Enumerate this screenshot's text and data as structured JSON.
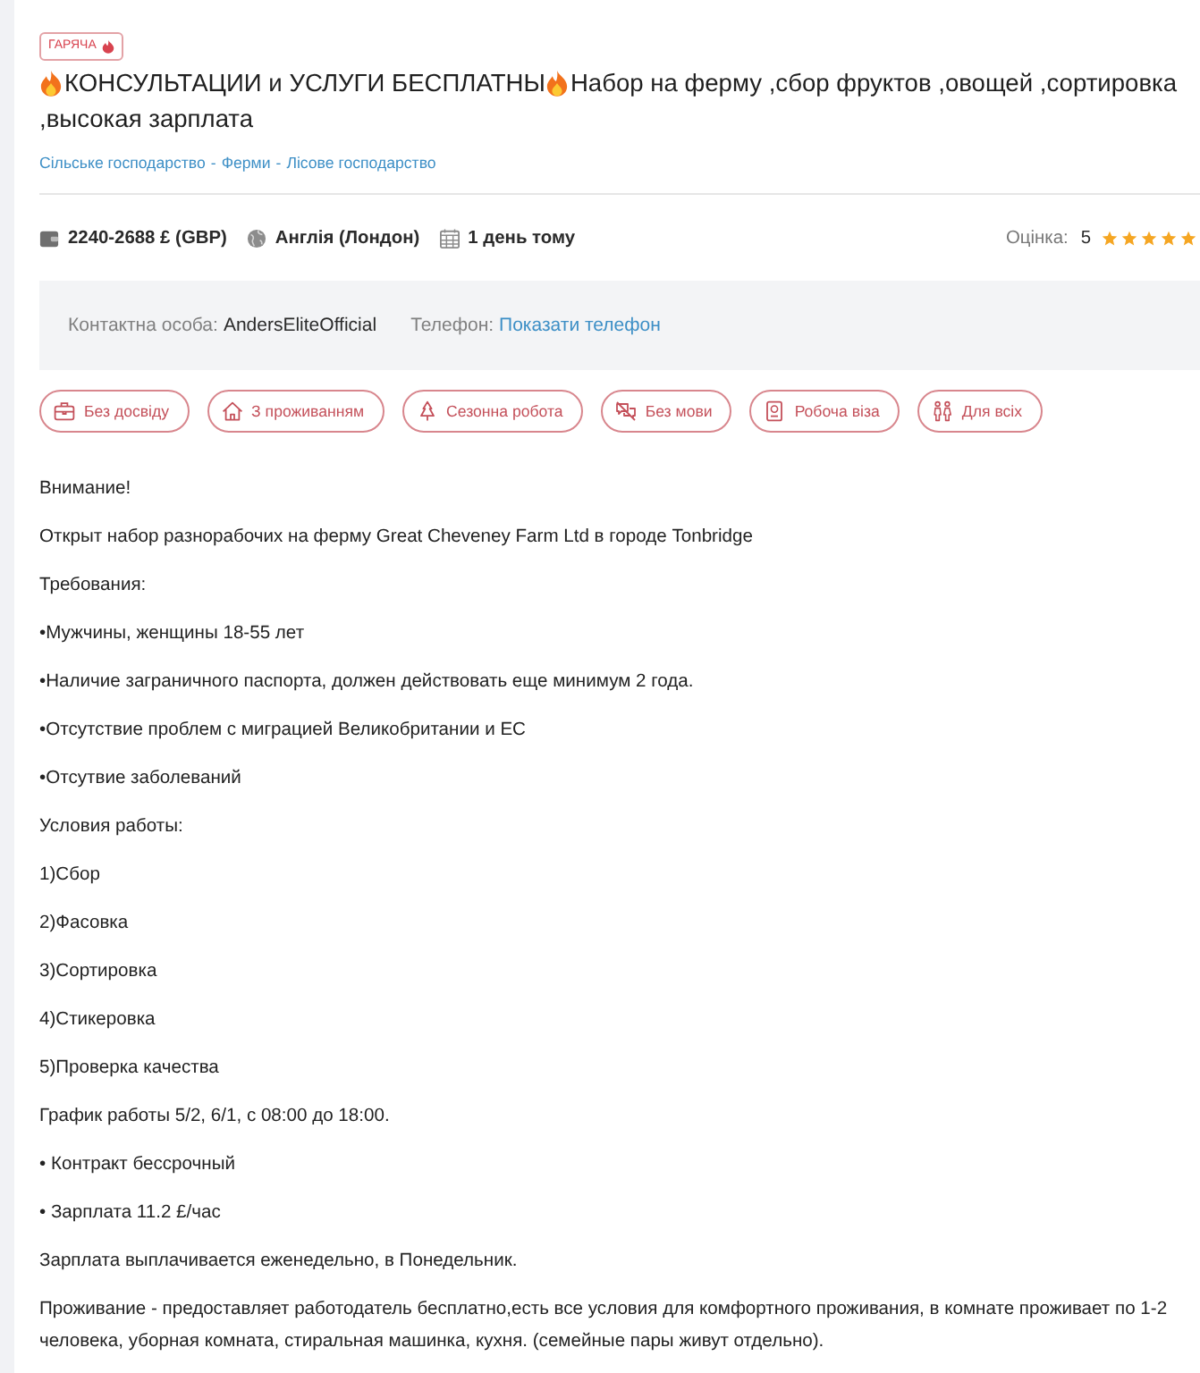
{
  "badge": {
    "label": "ГАРЯЧА"
  },
  "title": {
    "segments": [
      {
        "fire": true,
        "text": "КОНСУЛЬТАЦИИ и УСЛУГИ БЕСПЛАТНЫ"
      },
      {
        "fire": true,
        "text": "Набор на ферму ,сбор фруктов ,овощей ,сортировка"
      },
      {
        "fire": false,
        "text": ",высокая зарплата"
      }
    ]
  },
  "breadcrumbs": {
    "items": [
      "Сільське господарство",
      "Ферми",
      "Лісове господарство"
    ],
    "separator": "-"
  },
  "meta": {
    "salary": "2240-2688 £ (GBP)",
    "location": "Англія (Лондон)",
    "posted": "1 день тому"
  },
  "rating": {
    "label": "Оцінка:",
    "value": "5",
    "stars": 5
  },
  "contact": {
    "person_label": "Контактна особа:",
    "person": "AndersEliteOfficial",
    "phone_label": "Телефон:",
    "phone_link": "Показати телефон"
  },
  "tags": [
    {
      "kind": "briefcase",
      "label": "Без досвіду"
    },
    {
      "kind": "house",
      "label": "З проживанням"
    },
    {
      "kind": "tree",
      "label": "Сезонна робота"
    },
    {
      "kind": "speech",
      "label": "Без мови"
    },
    {
      "kind": "passport",
      "label": "Робоча віза"
    },
    {
      "kind": "people",
      "label": "Для всіх"
    }
  ],
  "description": [
    "Внимание!",
    "Открыт набор разнорабочих на ферму Great Cheveney Farm Ltd в городе Tonbridge",
    "Требования:",
    "•Мужчины, женщины 18-55 лет",
    "•Наличие заграничного паспорта, должен действовать еще минимум 2 года.",
    "•Отсутствие проблем с миграцией Великобритании и ЕС",
    "•Отсутвие заболеваний",
    "Условия работы:",
    "1)Сбор",
    "2)Фасовка",
    "3)Сортировка",
    "4)Стикеровка",
    "5)Проверка качества",
    "График работы 5/2, 6/1, с 08:00 до 18:00.",
    "• Контракт бессрочный",
    "• Зарплата 11.2 £/час",
    "Зарплата выплачивается еженедельно, в Понедельник.",
    "Проживание - предоставляет работодатель бесплатно,есть все условия для комфортного проживания, в комнате проживает по 1-2 человека, уборная комната, стиральная машинка, кухня. (семейные пары живут отдельно)."
  ]
}
